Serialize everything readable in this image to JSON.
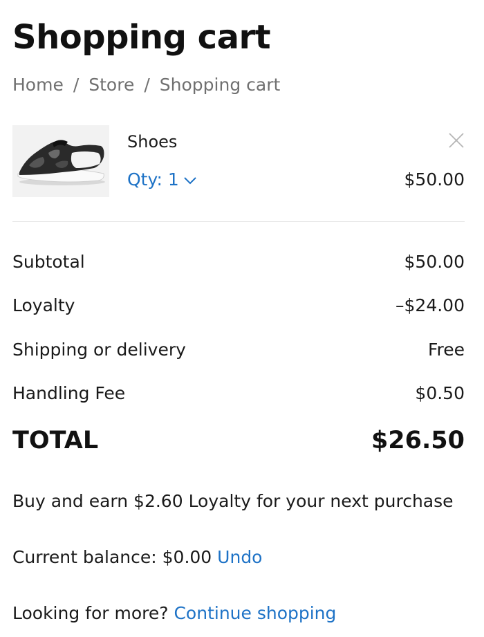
{
  "header": {
    "title": "Shopping cart"
  },
  "breadcrumb": {
    "items": [
      "Home",
      "Store",
      "Shopping cart"
    ],
    "separator": "/"
  },
  "cart": {
    "items": [
      {
        "name": "Shoes",
        "qty_label": "Qty: 1",
        "price": "$50.00",
        "image_icon": "shoe-product-image"
      }
    ],
    "remove_icon": "close-icon"
  },
  "summary": {
    "subtotal_label": "Subtotal",
    "subtotal_value": "$50.00",
    "loyalty_label": "Loyalty",
    "loyalty_value": "–$24.00",
    "shipping_label": "Shipping or delivery",
    "shipping_value": "Free",
    "handling_label": "Handling Fee",
    "handling_value": "$0.50",
    "total_label": "TOTAL",
    "total_value": "$26.50"
  },
  "loyalty_info": {
    "earn_text": "Buy and earn $2.60 Loyalty for your next purchase",
    "balance_text": "Current balance: $0.00",
    "undo_label": "Undo"
  },
  "footer": {
    "more_text": "Looking for more?",
    "continue_label": "Continue shopping"
  },
  "colors": {
    "accent_link": "#1d72c6",
    "text": "#1a1a1a",
    "muted": "#707070",
    "divider": "#e3e3e3"
  }
}
